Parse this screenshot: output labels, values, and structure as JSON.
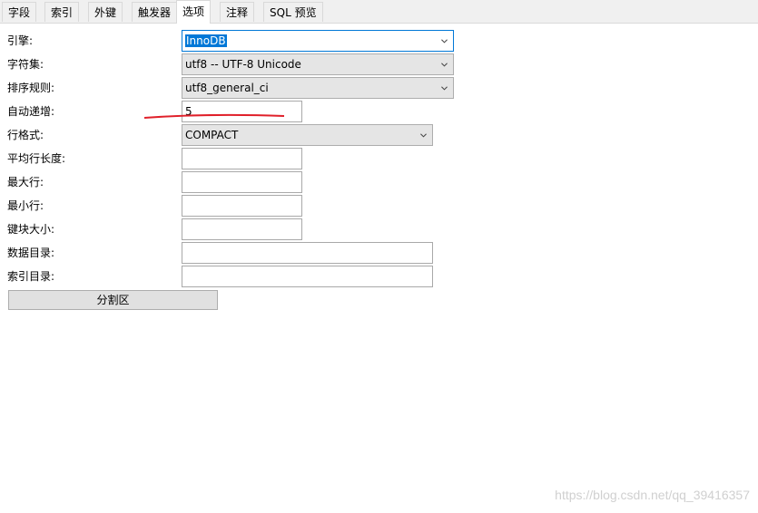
{
  "tabs": [
    {
      "label": "字段"
    },
    {
      "label": "索引"
    },
    {
      "label": "外键"
    },
    {
      "label": "触发器"
    },
    {
      "label": "选项"
    },
    {
      "label": "注释"
    },
    {
      "label": "SQL 预览"
    }
  ],
  "active_tab": "选项",
  "form": {
    "engine": {
      "label": "引擎:",
      "value": "InnoDB"
    },
    "charset": {
      "label": "字符集:",
      "value": "utf8 -- UTF-8 Unicode"
    },
    "collation": {
      "label": "排序规则:",
      "value": "utf8_general_ci"
    },
    "auto_increment": {
      "label": "自动递增:",
      "value": "5"
    },
    "row_format": {
      "label": "行格式:",
      "value": "COMPACT"
    },
    "avg_row_length": {
      "label": "平均行长度:",
      "value": ""
    },
    "max_rows": {
      "label": "最大行:",
      "value": ""
    },
    "min_rows": {
      "label": "最小行:",
      "value": ""
    },
    "key_block_size": {
      "label": "键块大小:",
      "value": ""
    },
    "data_directory": {
      "label": "数据目录:",
      "value": ""
    },
    "index_directory": {
      "label": "索引目录:",
      "value": ""
    }
  },
  "partition_button": "分割区",
  "watermark": "https://blog.csdn.net/qq_39416357",
  "colors": {
    "annotation_line": "#e0202a",
    "selection": "#0078d7"
  }
}
